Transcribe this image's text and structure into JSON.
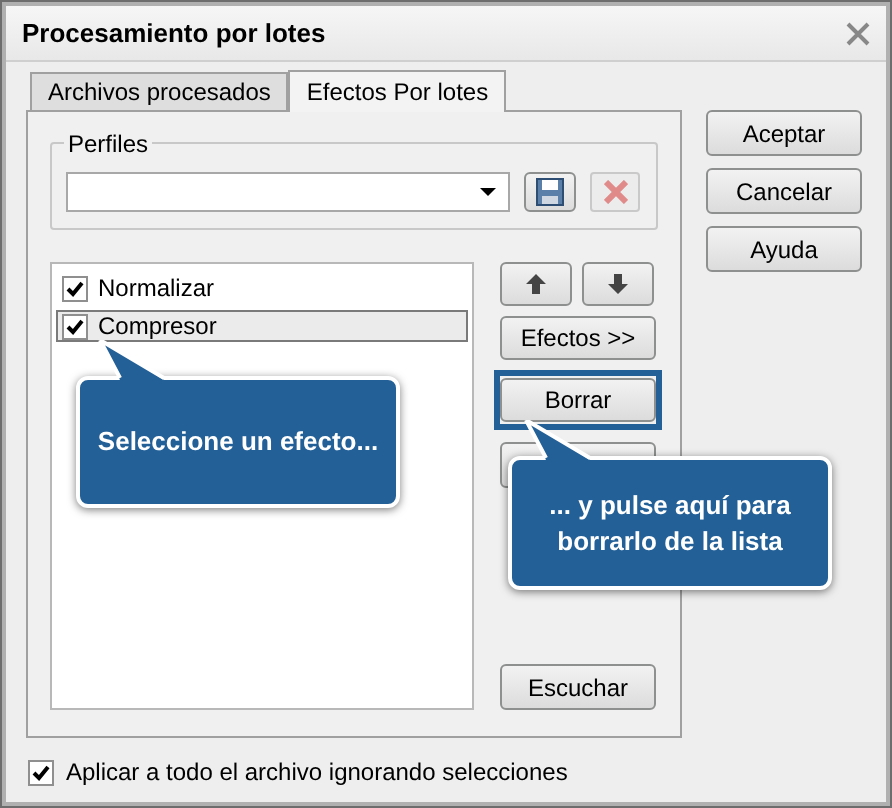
{
  "window": {
    "title": "Procesamiento por lotes"
  },
  "tabs": [
    {
      "label": "Archivos procesados",
      "selected": false
    },
    {
      "label": "Efectos Por lotes",
      "selected": true
    }
  ],
  "profiles": {
    "label": "Perfiles"
  },
  "effects": [
    {
      "label": "Normalizar",
      "checked": true,
      "selected": false
    },
    {
      "label": "Compresor",
      "checked": true,
      "selected": true
    }
  ],
  "side_buttons": [
    {
      "kind": "arrows"
    },
    {
      "kind": "text",
      "label": "Efectos >>",
      "highlighted": false
    },
    {
      "kind": "text",
      "label": "Borrar",
      "highlighted": true
    },
    {
      "kind": "blank"
    }
  ],
  "listen_button": "Escuchar",
  "dialog_buttons": [
    "Aceptar",
    "Cancelar",
    "Ayuda"
  ],
  "callouts": [
    {
      "text": "Seleccione un efecto..."
    },
    {
      "text": "... y pulse aquí para borrarlo de la lista"
    }
  ],
  "apply_all": {
    "label": "Aplicar a todo el archivo ignorando selecciones",
    "checked": true
  }
}
